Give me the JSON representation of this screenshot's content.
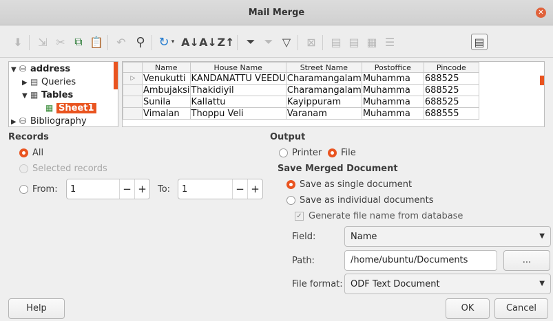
{
  "window": {
    "title": "Mail Merge"
  },
  "toolbar": {
    "icons": [
      "insert-icon",
      "data-to-fields-icon",
      "cut-icon",
      "copy-icon",
      "paste-icon",
      "undo-icon",
      "find-icon",
      "refresh-icon",
      "sort-ascending-icon",
      "sort-descending-icon",
      "sort-icon",
      "autofilter-icon",
      "standard-filter-icon",
      "apply-filter-icon",
      "remove-filter-icon",
      "data-to-text-icon",
      "data-to-fields-icon-2",
      "mail-merge-icon",
      "explorer-icon",
      "data-source-icon"
    ]
  },
  "tree": {
    "root": "address",
    "queries": "Queries",
    "tables": "Tables",
    "selected": "Sheet1",
    "bibliography": "Bibliography"
  },
  "grid": {
    "columns": [
      "Name",
      "House Name",
      "Street Name",
      "Postoffice",
      "Pincode"
    ],
    "rows": [
      [
        "Venukutti",
        "KANDANATTU VEEDU",
        "Charamangalam",
        "Muhamma",
        "688525"
      ],
      [
        "Ambujaksi",
        "Thakidiyil",
        "Charamangalam",
        "Muhamma",
        "688525"
      ],
      [
        "Sunila",
        "Kallattu",
        "Kayippuram",
        "Muhamma",
        "688525"
      ],
      [
        "Vimalan",
        "Thoppu Veli",
        "Varanam",
        "Muhamma",
        "688555"
      ]
    ]
  },
  "records": {
    "heading": "Records",
    "all": "All",
    "selected": "Selected records",
    "from": "From:",
    "from_value": "1",
    "to": "To:",
    "to_value": "1"
  },
  "output": {
    "heading": "Output",
    "printer": "Printer",
    "file": "File",
    "save_heading": "Save Merged Document",
    "single": "Save as single document",
    "individual": "Save as individual documents",
    "generate": "Generate file name from database",
    "field_label": "Field:",
    "field_value": "Name",
    "path_label": "Path:",
    "path_value": "/home/ubuntu/Documents",
    "browse": "...",
    "format_label": "File format:",
    "format_value": "ODF Text Document"
  },
  "buttons": {
    "help": "Help",
    "ok": "OK",
    "cancel": "Cancel"
  },
  "colors": {
    "accent": "#e95420"
  }
}
